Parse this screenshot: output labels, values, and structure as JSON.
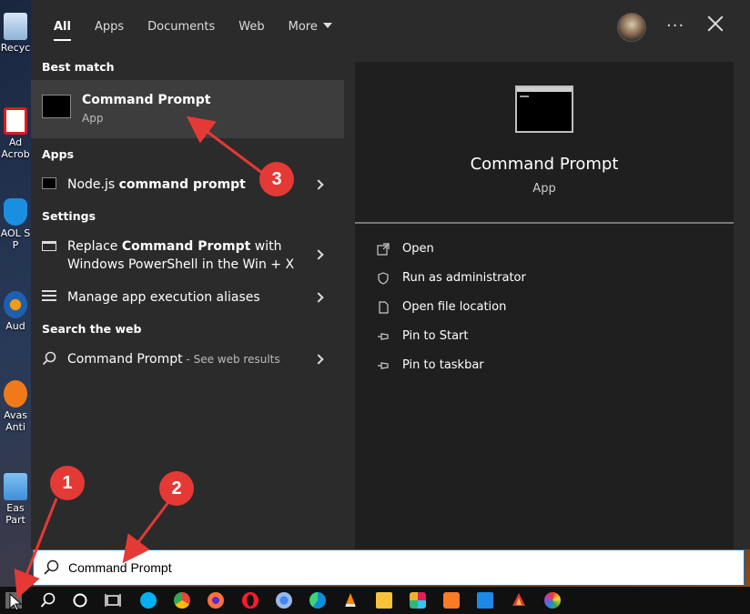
{
  "desktop_icons": [
    {
      "label": "Recyc",
      "color": "#4a86c8"
    },
    {
      "label": "Ad",
      "label2": "Acrob",
      "color": "#d71e1e"
    },
    {
      "label": "AOL S",
      "label2": "P",
      "color": "#1a8fe0"
    },
    {
      "label": "Aud",
      "color": "#1f5fb0"
    },
    {
      "label": "Avas",
      "label2": "Anti",
      "color": "#f07a1a"
    },
    {
      "label": "Eas",
      "label2": "Part",
      "color": "#3e8fd9"
    }
  ],
  "tabs": [
    {
      "label": "All",
      "active": true
    },
    {
      "label": "Apps"
    },
    {
      "label": "Documents"
    },
    {
      "label": "Web"
    },
    {
      "label": "More"
    }
  ],
  "sections": {
    "best_match": "Best match",
    "apps": "Apps",
    "settings": "Settings",
    "search_web": "Search the web"
  },
  "best_match": {
    "title": "Command Prompt",
    "subtitle": "App"
  },
  "apps": [
    {
      "prefix": "Node.js ",
      "bold": "command prompt"
    }
  ],
  "settings": [
    {
      "line1_prefix": "Replace ",
      "line1_bold": "Command Prompt",
      "line1_suffix": " with",
      "line2": "Windows PowerShell in the Win + X"
    },
    {
      "label": "Manage app execution aliases"
    }
  ],
  "web": {
    "query": "Command Prompt",
    "suffix": " - See web results"
  },
  "detail": {
    "title": "Command Prompt",
    "type": "App",
    "actions": [
      {
        "label": "Open",
        "icon": "open-icon"
      },
      {
        "label": "Run as administrator",
        "icon": "shield-icon"
      },
      {
        "label": "Open file location",
        "icon": "file-location-icon"
      },
      {
        "label": "Pin to Start",
        "icon": "pin-icon"
      },
      {
        "label": "Pin to taskbar",
        "icon": "pin-icon"
      }
    ]
  },
  "search": {
    "value": "Command Prompt"
  },
  "annotations": [
    "1",
    "2",
    "3"
  ],
  "annotation_color": "#e53935",
  "taskbar_apps": [
    {
      "name": "skype",
      "color": "#00aff0"
    },
    {
      "name": "chrome",
      "color": "#e8453c"
    },
    {
      "name": "firefox",
      "color": "#ff7139"
    },
    {
      "name": "opera",
      "color": "#ff1b2d"
    },
    {
      "name": "chrome-alt",
      "color": "#4285f4"
    },
    {
      "name": "edge",
      "color": "#0f8fd8"
    },
    {
      "name": "vlc",
      "color": "#ff8800"
    },
    {
      "name": "file-explorer",
      "color": "#f8c33b"
    },
    {
      "name": "slack",
      "color": "#e01e5a"
    },
    {
      "name": "xampp",
      "color": "#fb7a24"
    },
    {
      "name": "app-blue",
      "color": "#1e88e5"
    },
    {
      "name": "app-red",
      "color": "#e53935"
    },
    {
      "name": "app-rainbow",
      "color": "#ab47bc"
    }
  ]
}
